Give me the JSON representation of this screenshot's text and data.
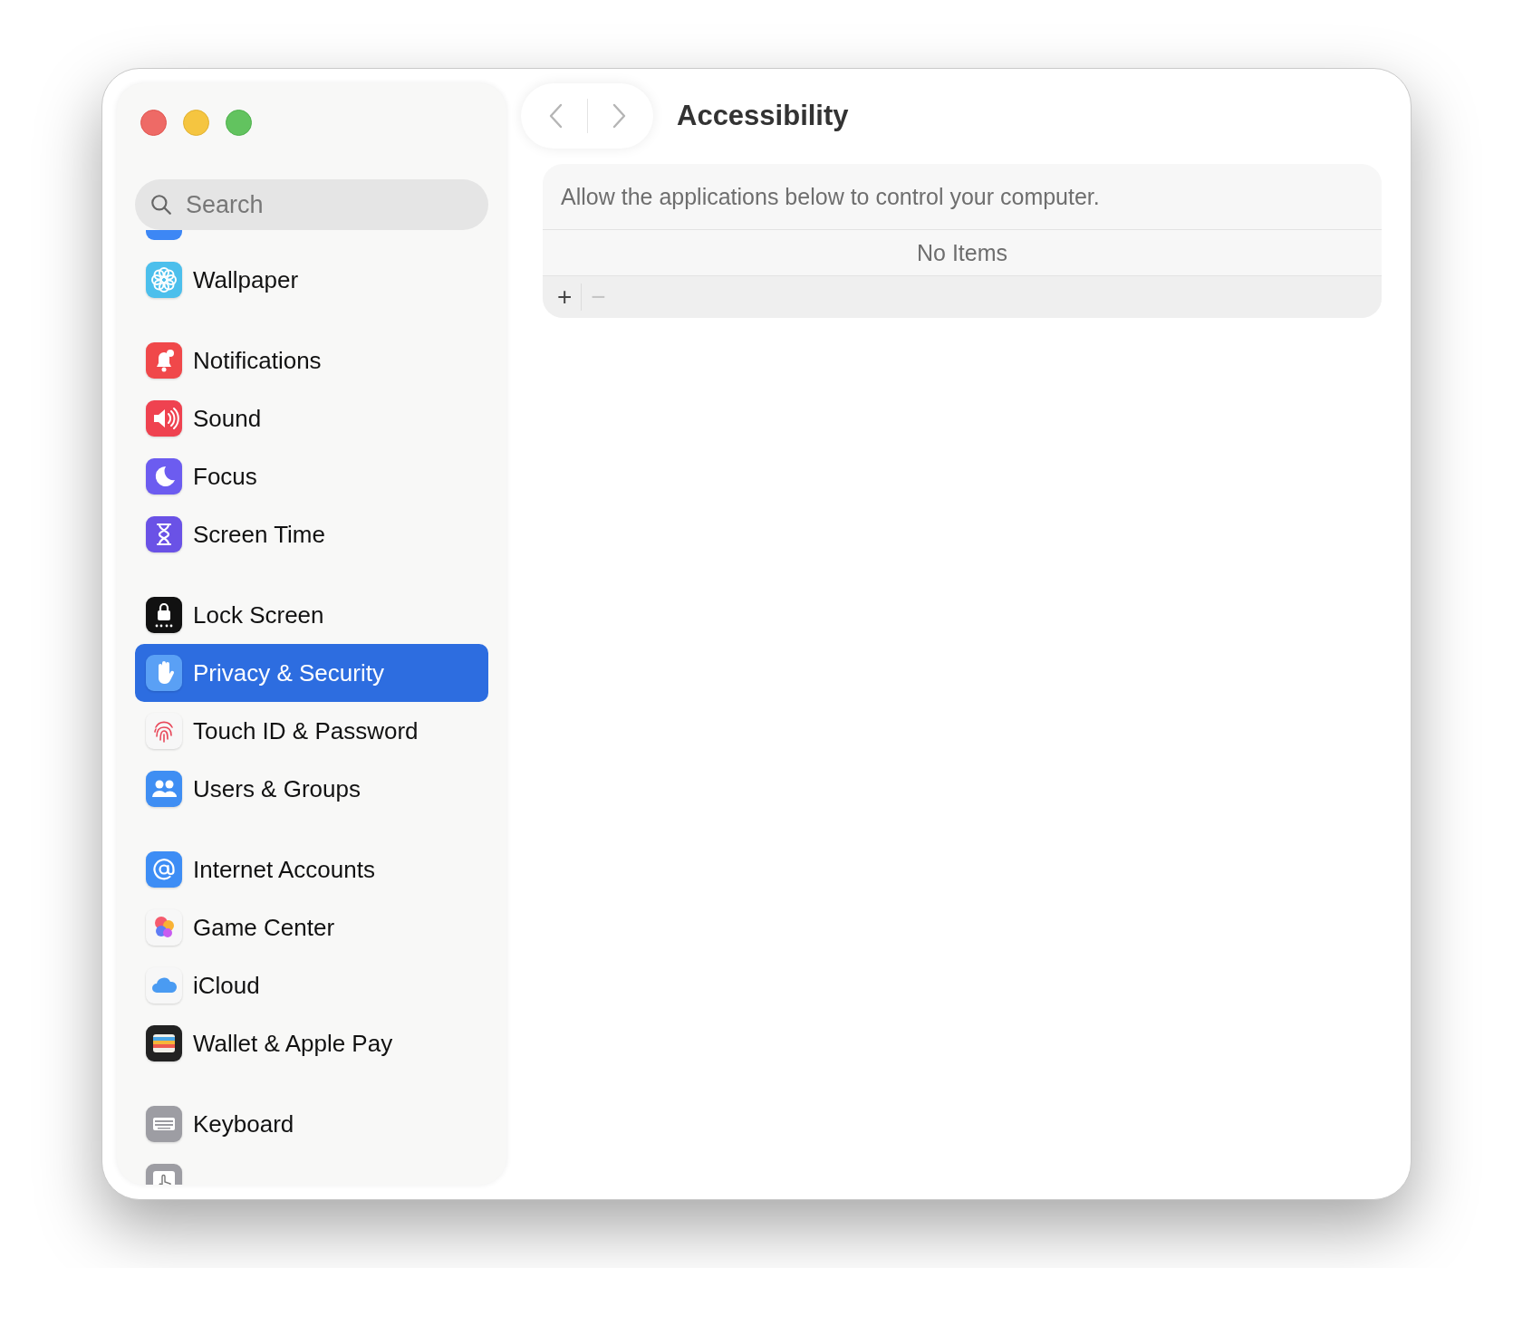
{
  "window": {
    "title": "Accessibility"
  },
  "sidebar": {
    "search": {
      "placeholder": "Search"
    },
    "groups": [
      [
        {
          "label": "Wallpaper",
          "kind": "wallpaper",
          "selected": false
        }
      ],
      [
        {
          "label": "Notifications",
          "kind": "notifications",
          "selected": false
        },
        {
          "label": "Sound",
          "kind": "sound",
          "selected": false
        },
        {
          "label": "Focus",
          "kind": "focus",
          "selected": false
        },
        {
          "label": "Screen Time",
          "kind": "screentime",
          "selected": false
        }
      ],
      [
        {
          "label": "Lock Screen",
          "kind": "lock",
          "selected": false
        },
        {
          "label": "Privacy & Security",
          "kind": "privacy",
          "selected": true
        },
        {
          "label": "Touch ID & Password",
          "kind": "touchid",
          "selected": false
        },
        {
          "label": "Users & Groups",
          "kind": "users",
          "selected": false
        }
      ],
      [
        {
          "label": "Internet Accounts",
          "kind": "internet",
          "selected": false
        },
        {
          "label": "Game Center",
          "kind": "gamecenter",
          "selected": false
        },
        {
          "label": "iCloud",
          "kind": "icloud",
          "selected": false
        },
        {
          "label": "Wallet & Apple Pay",
          "kind": "wallet",
          "selected": false
        }
      ],
      [
        {
          "label": "Keyboard",
          "kind": "keyboard",
          "selected": false
        },
        {
          "kind": "trackpad",
          "selected": false
        }
      ]
    ]
  },
  "panel": {
    "description": "Allow the applications below to control your computer.",
    "empty_text": "No Items",
    "buttons": [
      {
        "label": "+",
        "disabled": false
      },
      {
        "label": "−",
        "disabled": true
      }
    ]
  }
}
